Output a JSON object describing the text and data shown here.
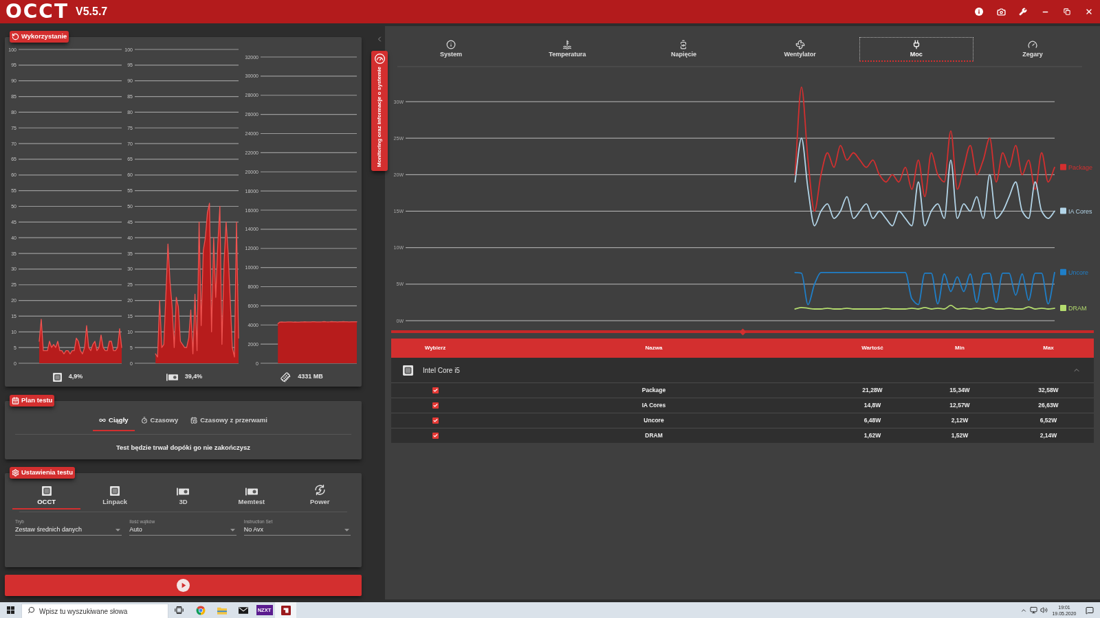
{
  "title_bar": {
    "logo": "OCCT",
    "version": "V5.5.7"
  },
  "usage": {
    "title": "Wykorzystanie",
    "charts": [
      {
        "kind": "cpu",
        "reading": "4,9%",
        "chart_data": {
          "type": "area",
          "grid": true,
          "categories": [
            null,
            null,
            null,
            null,
            null,
            null,
            null,
            null,
            null,
            null,
            null,
            null,
            null,
            null,
            null,
            null,
            null,
            null,
            null,
            null,
            null,
            null,
            null,
            null,
            null,
            null,
            null,
            null,
            null,
            null,
            null,
            null,
            null,
            null,
            null,
            null,
            null,
            null,
            null,
            null,
            null,
            null,
            null,
            null,
            null,
            null,
            null,
            null,
            null,
            null,
            null
          ],
          "values": [
            null,
            null,
            null,
            null,
            null,
            null,
            null,
            null,
            null,
            null,
            7,
            14,
            4,
            4,
            4,
            7,
            5,
            6,
            5,
            7,
            4,
            4,
            3,
            4,
            4,
            3,
            4,
            4,
            8,
            7,
            4,
            3,
            5,
            12,
            5,
            4,
            6,
            7,
            4,
            5,
            9,
            5,
            4,
            4,
            7,
            7,
            4,
            4,
            5,
            11,
            5
          ],
          "ylim": [
            0,
            100
          ],
          "yticks": [
            100,
            95,
            90,
            85,
            80,
            75,
            70,
            65,
            60,
            55,
            50,
            45,
            40,
            35,
            30,
            25,
            20,
            15,
            10,
            5,
            0
          ]
        }
      },
      {
        "kind": "gpu",
        "reading": "39,4%",
        "chart_data": {
          "type": "area",
          "grid": true,
          "categories": [
            null,
            null,
            null,
            null,
            null,
            null,
            null,
            null,
            null,
            null,
            null,
            null,
            null,
            null,
            null,
            null,
            null,
            null,
            null,
            null,
            null,
            null,
            null,
            null,
            null,
            null,
            null,
            null,
            null,
            null,
            null,
            null,
            null,
            null,
            null,
            null,
            null,
            null,
            null,
            null,
            null,
            null,
            null,
            null,
            null,
            null,
            null,
            null,
            null,
            null,
            null
          ],
          "values": [
            null,
            null,
            null,
            null,
            null,
            null,
            null,
            null,
            null,
            null,
            3,
            2,
            20,
            5,
            6,
            22,
            38,
            26,
            18,
            5,
            21,
            18,
            7,
            6,
            5,
            5,
            8,
            17,
            3,
            22,
            4,
            45,
            12,
            36,
            40,
            48,
            51,
            10,
            40,
            21,
            38,
            50,
            6,
            32,
            45,
            35,
            20,
            5,
            2,
            45,
            8
          ],
          "ylim": [
            0,
            100
          ],
          "yticks": [
            100,
            95,
            90,
            85,
            80,
            75,
            70,
            65,
            60,
            55,
            50,
            45,
            40,
            35,
            30,
            25,
            20,
            15,
            10,
            5,
            0
          ]
        }
      },
      {
        "kind": "ram",
        "reading": "4331 MB",
        "chart_data": {
          "type": "area",
          "grid": true,
          "categories": [
            null,
            null,
            null,
            null,
            null,
            null,
            null,
            null,
            null,
            null,
            null,
            null,
            null,
            null,
            null,
            null,
            null,
            null,
            null,
            null,
            null,
            null,
            null,
            null,
            null,
            null,
            null,
            null,
            null,
            null,
            null,
            null,
            null,
            null,
            null,
            null,
            null,
            null,
            null,
            null,
            null,
            null,
            null,
            null,
            null,
            null,
            null,
            null,
            null,
            null,
            null
          ],
          "values": [
            null,
            null,
            null,
            null,
            null,
            null,
            null,
            null,
            null,
            4150,
            4300,
            4310,
            4300,
            4300,
            4310,
            4320,
            4310,
            4300,
            4310,
            4300,
            4300,
            4310,
            4320,
            4330,
            4320,
            4310,
            4320,
            4330,
            4330,
            4320,
            4310,
            4320,
            4330,
            4340,
            4330,
            4320,
            4330,
            4340,
            4330,
            4330,
            4320,
            4330,
            4330,
            4340,
            4330,
            4330,
            4320,
            4330,
            4330,
            4330,
            4330
          ],
          "ylim": [
            0,
            32000
          ],
          "yticks": [
            32000,
            30000,
            28000,
            26000,
            24000,
            22000,
            20000,
            18000,
            16000,
            14000,
            12000,
            10000,
            8000,
            6000,
            4000,
            2000,
            0
          ]
        }
      }
    ]
  },
  "test_plan": {
    "title": "Plan testu",
    "tabs": [
      {
        "kind": "infinity",
        "label": "Ciągły",
        "selected": true
      },
      {
        "kind": "timer",
        "label": "Czasowy",
        "selected": false
      },
      {
        "kind": "calendar",
        "label": "Czasowy z przerwami",
        "selected": false
      }
    ],
    "description": "Test będzie trwał dopóki go nie zakończysz"
  },
  "test_settings": {
    "title": "Ustawienia testu",
    "tabs": [
      {
        "kind": "cpu",
        "label": "OCCT",
        "selected": true
      },
      {
        "kind": "cpu",
        "label": "Linpack",
        "selected": false
      },
      {
        "kind": "gpu",
        "label": "3D",
        "selected": false
      },
      {
        "kind": "gpu",
        "label": "Memtest",
        "selected": false
      },
      {
        "kind": "power",
        "label": "Power",
        "selected": false
      }
    ],
    "fields": [
      {
        "label": "Tryb",
        "value": "Zestaw średnich danych"
      },
      {
        "label": "Ilość wątków",
        "value": "Auto"
      },
      {
        "label": "Instruction Set",
        "value": "No Avx"
      }
    ]
  },
  "side_tab": {
    "label": "Monitoring oraz informacje o systemie"
  },
  "monitor": {
    "tabs": [
      {
        "kind": "info",
        "label": "System",
        "selected": false
      },
      {
        "kind": "temperature",
        "label": "Temperatura",
        "selected": false
      },
      {
        "kind": "voltage",
        "label": "Napięcie",
        "selected": false
      },
      {
        "kind": "fan",
        "label": "Wentylator",
        "selected": false
      },
      {
        "kind": "power",
        "label": "Moc",
        "selected": true
      },
      {
        "kind": "clock",
        "label": "Zegary",
        "selected": false
      }
    ],
    "chart_data": {
      "type": "line",
      "grid": true,
      "legend": true,
      "categories": [
        null,
        null,
        null,
        null,
        null,
        null,
        null,
        null,
        null,
        null,
        null,
        null,
        null,
        null,
        null,
        null,
        null,
        null,
        null,
        null,
        null,
        null,
        null,
        null,
        null,
        null,
        null,
        null,
        null,
        null,
        null,
        null,
        null,
        null,
        null,
        null,
        null,
        null,
        null,
        null,
        null,
        null,
        null,
        null,
        null,
        null,
        null,
        null,
        null,
        null,
        null,
        null,
        null,
        null,
        null,
        null,
        null,
        null,
        null,
        null,
        null,
        null,
        null,
        null,
        null,
        null,
        null,
        null,
        null,
        null,
        null,
        null,
        null,
        null,
        null,
        null,
        null,
        null,
        null,
        null,
        null,
        null,
        null,
        null,
        null,
        null,
        null,
        null,
        null,
        null,
        null,
        null,
        null,
        null,
        null,
        null,
        null,
        null,
        null,
        null,
        null
      ],
      "ylim": [
        0,
        34.8
      ],
      "yticks": [
        {
          "value": 0,
          "label": "0W"
        },
        {
          "value": 5,
          "label": "5W"
        },
        {
          "value": 10,
          "label": "10W"
        },
        {
          "value": 15,
          "label": "15W"
        },
        {
          "value": 20,
          "label": "20W"
        },
        {
          "value": 25,
          "label": "25W"
        },
        {
          "value": 30,
          "label": "30W"
        }
      ],
      "series": [
        {
          "name": "Package",
          "color": "#d32f2f",
          "values": [
            null,
            null,
            null,
            null,
            null,
            null,
            null,
            null,
            null,
            null,
            null,
            null,
            null,
            null,
            null,
            null,
            null,
            null,
            null,
            null,
            null,
            null,
            null,
            null,
            null,
            null,
            null,
            null,
            null,
            null,
            null,
            null,
            null,
            null,
            null,
            null,
            null,
            null,
            null,
            null,
            null,
            null,
            null,
            null,
            null,
            null,
            null,
            null,
            null,
            null,
            null,
            null,
            null,
            null,
            null,
            null,
            null,
            null,
            null,
            null,
            20,
            32,
            22,
            15,
            20,
            23,
            21,
            24,
            22,
            23,
            22,
            21,
            22,
            20,
            19,
            20,
            19,
            21,
            18,
            22,
            17,
            23,
            20,
            19,
            26,
            18,
            21,
            24,
            20,
            22,
            25,
            19,
            23,
            21,
            24,
            20,
            22,
            18,
            23,
            19,
            21
          ]
        },
        {
          "name": "IA Cores",
          "color": "#b3d5e8",
          "values": [
            null,
            null,
            null,
            null,
            null,
            null,
            null,
            null,
            null,
            null,
            null,
            null,
            null,
            null,
            null,
            null,
            null,
            null,
            null,
            null,
            null,
            null,
            null,
            null,
            null,
            null,
            null,
            null,
            null,
            null,
            null,
            null,
            null,
            null,
            null,
            null,
            null,
            null,
            null,
            null,
            null,
            null,
            null,
            null,
            null,
            null,
            null,
            null,
            null,
            null,
            null,
            null,
            null,
            null,
            null,
            null,
            null,
            null,
            null,
            null,
            19,
            25,
            18,
            13,
            15,
            16,
            14,
            15,
            17,
            14,
            15,
            16,
            14,
            15,
            14,
            13,
            15,
            14,
            13,
            19,
            13,
            15,
            16,
            14,
            22,
            14,
            16,
            15,
            17,
            14,
            20,
            14,
            15,
            17,
            19,
            15,
            14,
            19,
            15,
            14,
            15
          ]
        },
        {
          "name": "Uncore",
          "color": "#1f7fc8",
          "values": [
            null,
            null,
            null,
            null,
            null,
            null,
            null,
            null,
            null,
            null,
            null,
            null,
            null,
            null,
            null,
            null,
            null,
            null,
            null,
            null,
            null,
            null,
            null,
            null,
            null,
            null,
            null,
            null,
            null,
            null,
            null,
            null,
            null,
            null,
            null,
            null,
            null,
            null,
            null,
            null,
            null,
            null,
            null,
            null,
            null,
            null,
            null,
            null,
            null,
            null,
            null,
            null,
            null,
            null,
            null,
            null,
            null,
            null,
            null,
            null,
            6.6,
            6.5,
            2.2,
            5,
            6.6,
            6.6,
            6.6,
            6.6,
            6.6,
            6.6,
            6.6,
            6.6,
            6.6,
            6.6,
            6.6,
            6.6,
            6.6,
            6.6,
            3,
            2.2,
            6.5,
            6.5,
            2.3,
            6.4,
            4,
            6,
            4,
            6.4,
            2.5,
            6.4,
            6.5,
            2.5,
            6.5,
            6.5,
            3.5,
            6.4,
            2.8,
            6.5,
            6.5,
            2.3,
            6.6
          ]
        },
        {
          "name": "DRAM",
          "color": "#b4dc6e",
          "values": [
            null,
            null,
            null,
            null,
            null,
            null,
            null,
            null,
            null,
            null,
            null,
            null,
            null,
            null,
            null,
            null,
            null,
            null,
            null,
            null,
            null,
            null,
            null,
            null,
            null,
            null,
            null,
            null,
            null,
            null,
            null,
            null,
            null,
            null,
            null,
            null,
            null,
            null,
            null,
            null,
            null,
            null,
            null,
            null,
            null,
            null,
            null,
            null,
            null,
            null,
            null,
            null,
            null,
            null,
            null,
            null,
            null,
            null,
            null,
            null,
            1.6,
            1.8,
            1.7,
            1.6,
            1.6,
            1.7,
            1.6,
            1.6,
            1.7,
            1.6,
            1.6,
            1.6,
            1.6,
            1.6,
            1.7,
            1.6,
            1.6,
            1.6,
            1.7,
            1.6,
            1.8,
            1.6,
            1.7,
            1.6,
            2.1,
            1.6,
            1.7,
            1.6,
            1.7,
            1.6,
            1.8,
            1.6,
            1.6,
            1.7,
            1.6,
            1.6,
            1.9,
            1.6,
            1.7,
            1.6,
            1.7
          ]
        }
      ]
    },
    "timeline": {
      "level": 0.5
    },
    "table": {
      "columns": [
        "Wybierz",
        "Nazwa",
        "Wartość",
        "Min",
        "Max"
      ],
      "groups": [
        {
          "name": "Intel Core i5",
          "expanded": true,
          "rows": [
            {
              "checked": true,
              "name": "Package",
              "value": "21,28W",
              "min": "15,34W",
              "max": "32,58W"
            },
            {
              "checked": true,
              "name": "IA Cores",
              "value": "14,8W",
              "min": "12,57W",
              "max": "26,63W"
            },
            {
              "checked": true,
              "name": "Uncore",
              "value": "6,48W",
              "min": "2,12W",
              "max": "6,52W"
            },
            {
              "checked": true,
              "name": "DRAM",
              "value": "1,62W",
              "min": "1,52W",
              "max": "2,14W"
            }
          ]
        }
      ]
    }
  },
  "taskbar": {
    "search": {
      "placeholder": "Wpisz tu wyszukiwane słowa"
    },
    "apps": [
      {
        "kind": "task_view",
        "active": false
      },
      {
        "kind": "browser",
        "active": false
      },
      {
        "kind": "folder",
        "active": false
      },
      {
        "kind": "mail",
        "active": false
      },
      {
        "kind": "tile",
        "label": "NZXT",
        "active": false
      },
      {
        "kind": "app",
        "active": true
      }
    ],
    "clock": {
      "time": "19:01",
      "date": "19.05.2020"
    }
  }
}
